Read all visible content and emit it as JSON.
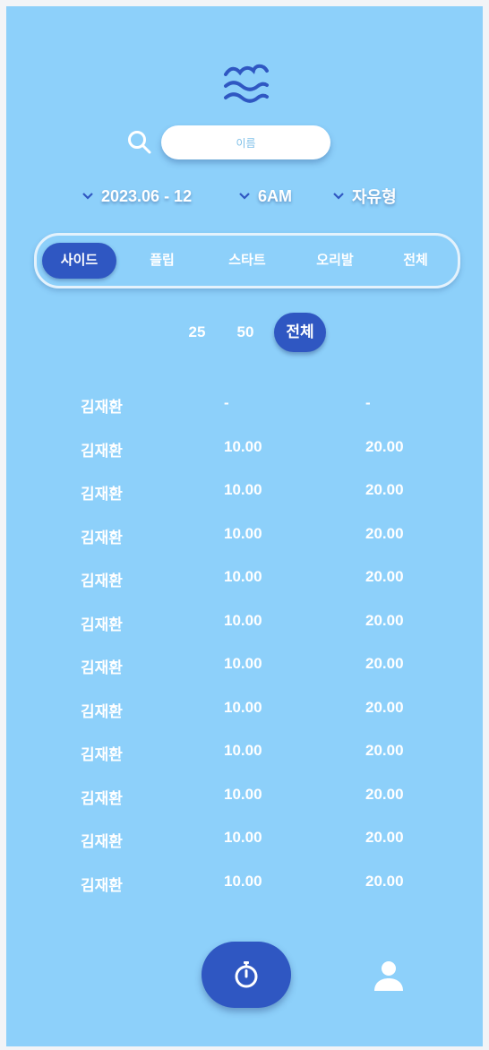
{
  "search": {
    "placeholder": "이름"
  },
  "filters": {
    "date": "2023.06 - 12",
    "time": "6AM",
    "style": "자유형"
  },
  "stroke_tabs": [
    "사이드",
    "플립",
    "스타트",
    "오리발",
    "전체"
  ],
  "distance_tabs": [
    "25",
    "50",
    "전체"
  ],
  "records": [
    [
      "김재환",
      "-",
      "-"
    ],
    [
      "김재환",
      "10.00",
      "20.00"
    ],
    [
      "김재환",
      "10.00",
      "20.00"
    ],
    [
      "김재환",
      "10.00",
      "20.00"
    ],
    [
      "김재환",
      "10.00",
      "20.00"
    ],
    [
      "김재환",
      "10.00",
      "20.00"
    ],
    [
      "김재환",
      "10.00",
      "20.00"
    ],
    [
      "김재환",
      "10.00",
      "20.00"
    ],
    [
      "김재환",
      "10.00",
      "20.00"
    ],
    [
      "김재환",
      "10.00",
      "20.00"
    ],
    [
      "김재환",
      "10.00",
      "20.00"
    ],
    [
      "김재환",
      "10.00",
      "20.00"
    ]
  ],
  "icons": {
    "logo": "waves-icon",
    "search": "search-icon",
    "dropdown": "chevron-down-icon",
    "timer": "stopwatch-icon",
    "profile": "person-icon"
  },
  "colors": {
    "background": "#8dd0fa",
    "accent": "#2f57c2",
    "text": "#ffffff"
  }
}
